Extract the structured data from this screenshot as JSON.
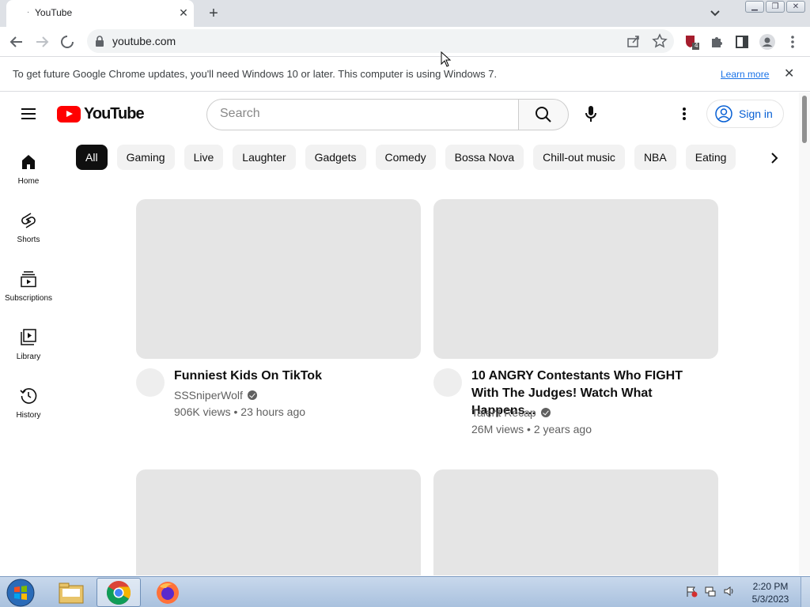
{
  "browser": {
    "tab_title": "YouTube",
    "tab_loading_glyph": "·",
    "new_tab_label": "+",
    "url": "youtube.com",
    "extension_badge": "4",
    "infobar_message": "To get future Google Chrome updates, you'll need Windows 10 or later. This computer is using Windows 7.",
    "infobar_link": "Learn more"
  },
  "youtube": {
    "logo_text": "YouTube",
    "search_placeholder": "Search",
    "sign_in_label": "Sign in",
    "sidebar": [
      {
        "label": "Home",
        "icon": "home-icon"
      },
      {
        "label": "Shorts",
        "icon": "shorts-icon"
      },
      {
        "label": "Subscriptions",
        "icon": "subscriptions-icon"
      },
      {
        "label": "Library",
        "icon": "library-icon"
      },
      {
        "label": "History",
        "icon": "history-icon"
      }
    ],
    "chips": [
      "All",
      "Gaming",
      "Live",
      "Laughter",
      "Gadgets",
      "Comedy",
      "Bossa Nova",
      "Chill-out music",
      "NBA",
      "Eating"
    ],
    "videos": [
      {
        "title": "Funniest Kids On TikTok",
        "channel": "SSSniperWolf",
        "views": "906K views",
        "age": "23 hours ago"
      },
      {
        "title": "10 ANGRY Contestants Who FIGHT With The Judges! Watch What Happens...",
        "channel": "Talent Recap",
        "views": "26M views",
        "age": "2 years ago"
      }
    ],
    "meta_separator": "•"
  },
  "taskbar": {
    "time": "2:20 PM",
    "date": "5/3/2023"
  },
  "colors": {
    "youtube_red": "#ff0000",
    "link_blue": "#1a73e8",
    "sign_in_blue": "#065fd4"
  }
}
